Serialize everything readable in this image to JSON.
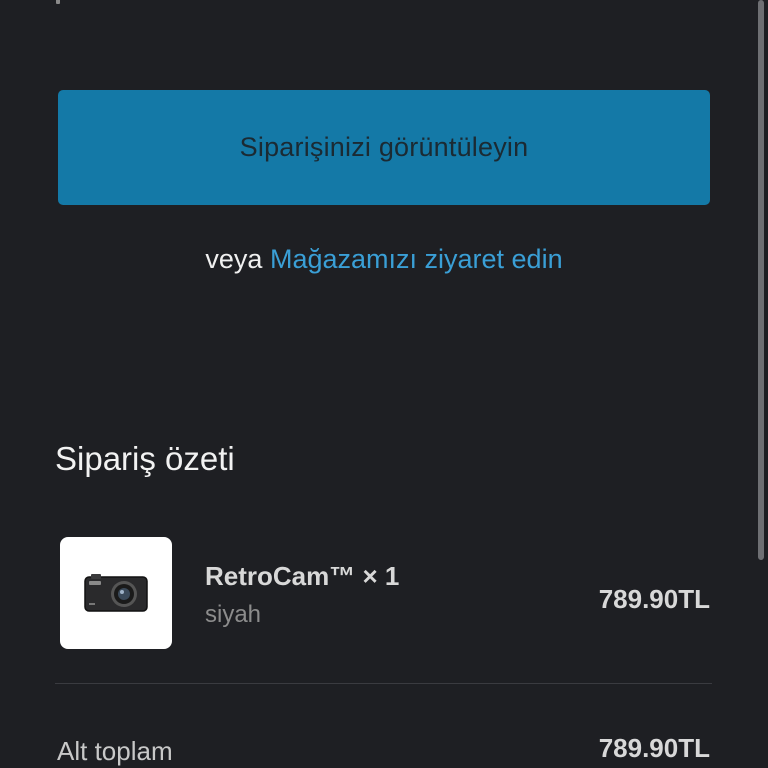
{
  "cta": {
    "label": "Siparişinizi görüntüleyin"
  },
  "alt_action": {
    "prefix": "veya",
    "link_label": "Mağazamızı ziyaret edin"
  },
  "summary": {
    "title": "Sipariş özeti",
    "items": [
      {
        "name": "RetroCam™ × 1",
        "variant": "siyah",
        "price": "789.90TL",
        "thumbnail_icon": "camera-icon"
      }
    ],
    "subtotal_label": "Alt toplam",
    "subtotal_value": "789.90TL"
  },
  "colors": {
    "background": "#1e1f23",
    "accent": "#1479a7",
    "link": "#3a9fd6"
  }
}
